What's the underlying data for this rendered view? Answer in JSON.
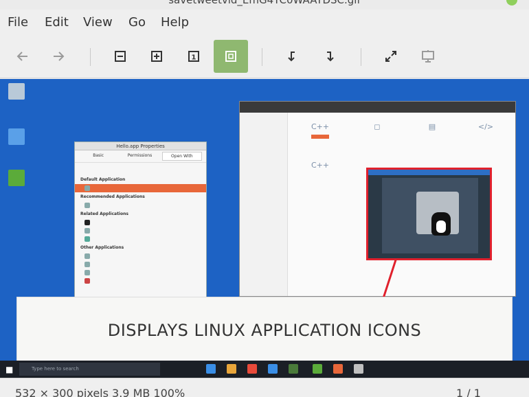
{
  "window": {
    "title": "savetweetvid_EmG4YC0WAAYDSC.gif"
  },
  "menu": {
    "file": "File",
    "edit": "Edit",
    "view": "View",
    "go": "Go",
    "help": "Help"
  },
  "toolbar": {
    "back_icon": "arrow-left-icon",
    "forward_icon": "arrow-right-icon",
    "zoom_out_icon": "zoom-out-icon",
    "zoom_in_icon": "zoom-in-icon",
    "original_size_icon": "original-size-icon",
    "best_fit_icon": "best-fit-icon",
    "rotate_left_icon": "rotate-left-icon",
    "rotate_right_icon": "rotate-right-icon",
    "fullscreen_icon": "fullscreen-icon",
    "slideshow_icon": "slideshow-icon",
    "original_size_label": "1",
    "accent_color": "#8fb870"
  },
  "image": {
    "caption": "DISPLAYS LINUX APPLICATION ICONS",
    "taskbar_search": "Type here to search",
    "properties_title": "Hello.app Properties",
    "properties_tabs": [
      "Basic",
      "Permissions",
      "Open With"
    ],
    "properties_sections": [
      "Default Application",
      "Recommended Applications",
      "Related Applications",
      "Other Applications"
    ]
  },
  "status": {
    "info": "532 × 300 pixels  3.9 MB  100%",
    "pager": "1 / 1"
  }
}
